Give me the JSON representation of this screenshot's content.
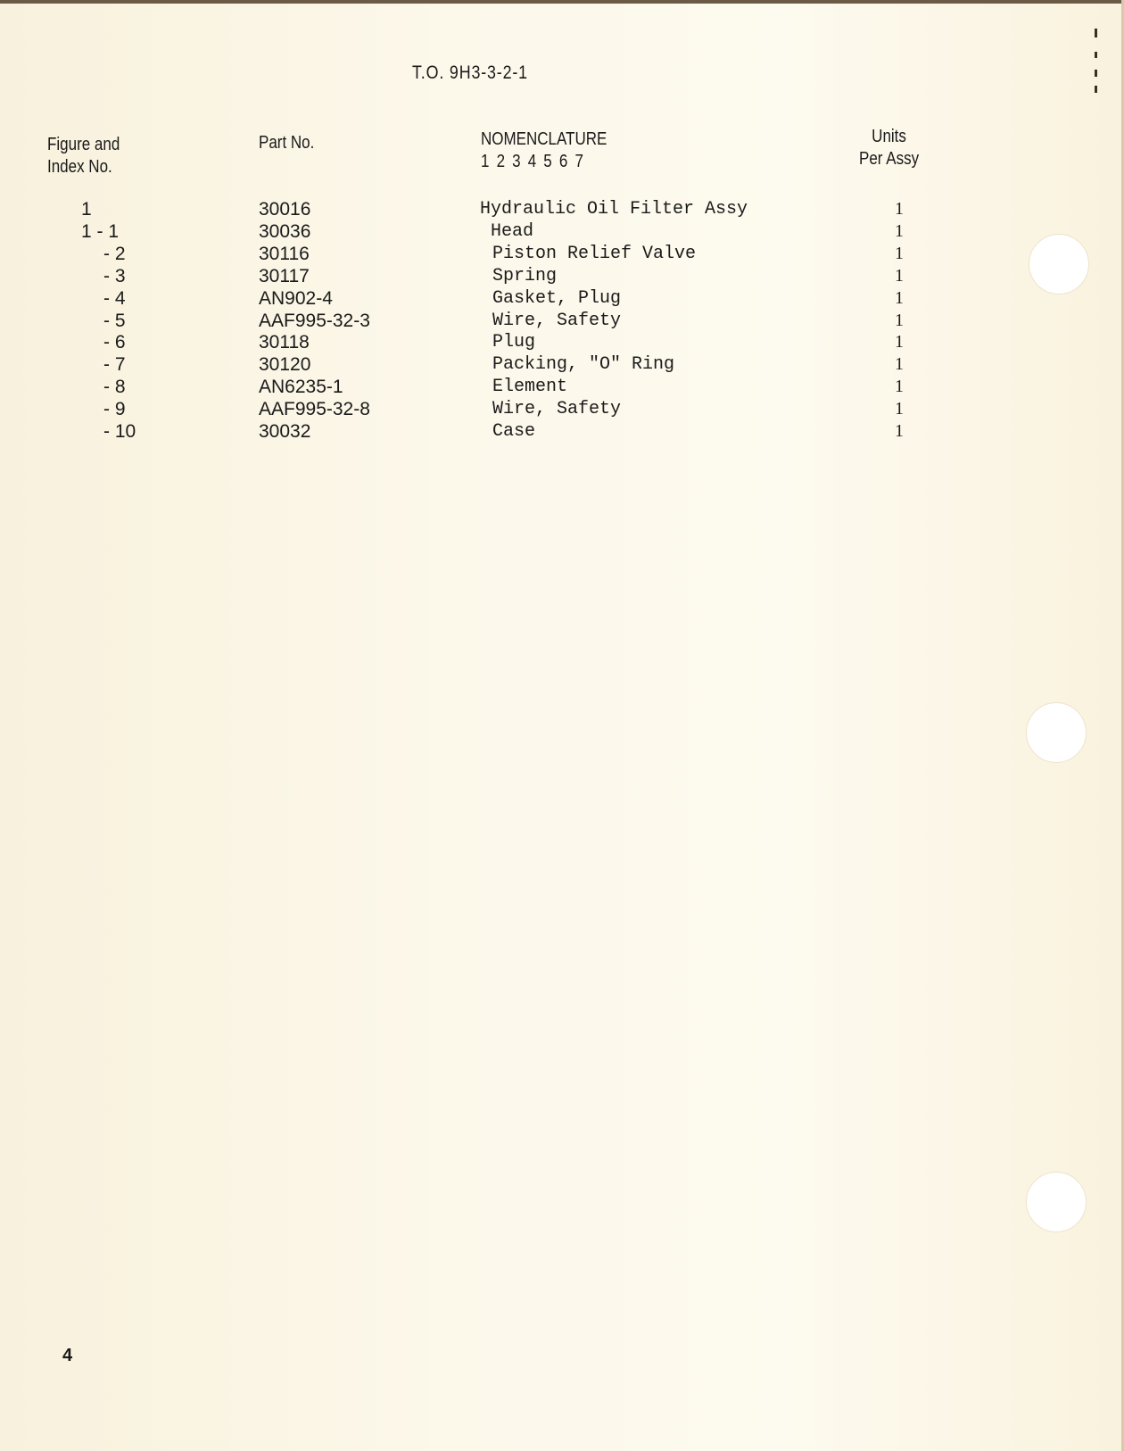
{
  "document": {
    "to_number": "T.O. 9H3-3-2-1",
    "page_number": "4"
  },
  "table": {
    "headers": {
      "figure_index_line1": "Figure and",
      "figure_index_line2": "Index No.",
      "part_no": "Part No.",
      "nomenclature": "NOMENCLATURE",
      "nomenclature_levels": "1 2 3 4 5 6 7",
      "units_line1": "Units",
      "units_line2": "Per Assy"
    },
    "rows": [
      {
        "figure_index": "1",
        "part_no": "30016",
        "nomenclature": "Hydraulic Oil Filter Assy",
        "units": "1"
      },
      {
        "figure_index": "1 - 1",
        "part_no": "30036",
        "nomenclature": "Head",
        "units": "1"
      },
      {
        "figure_index": "- 2",
        "part_no": "30116",
        "nomenclature": "Piston Relief Valve",
        "units": "1"
      },
      {
        "figure_index": "- 3",
        "part_no": "30117",
        "nomenclature": "Spring",
        "units": "1"
      },
      {
        "figure_index": "- 4",
        "part_no": "AN902-4",
        "nomenclature": "Gasket, Plug",
        "units": "1"
      },
      {
        "figure_index": "- 5",
        "part_no": "AAF995-32-3",
        "nomenclature": "Wire, Safety",
        "units": "1"
      },
      {
        "figure_index": "- 6",
        "part_no": "30118",
        "nomenclature": "Plug",
        "units": "1"
      },
      {
        "figure_index": "- 7",
        "part_no": "30120",
        "nomenclature": "Packing, \"O\" Ring",
        "units": "1"
      },
      {
        "figure_index": "- 8",
        "part_no": "AN6235-1",
        "nomenclature": "Element",
        "units": "1"
      },
      {
        "figure_index": "- 9",
        "part_no": "AAF995-32-8",
        "nomenclature": "Wire, Safety",
        "units": "1"
      },
      {
        "figure_index": "- 10",
        "part_no": "30032",
        "nomenclature": "Case",
        "units": "1"
      }
    ]
  },
  "colors": {
    "paper": "#fbf6e6",
    "ink": "#1a1a1a"
  }
}
